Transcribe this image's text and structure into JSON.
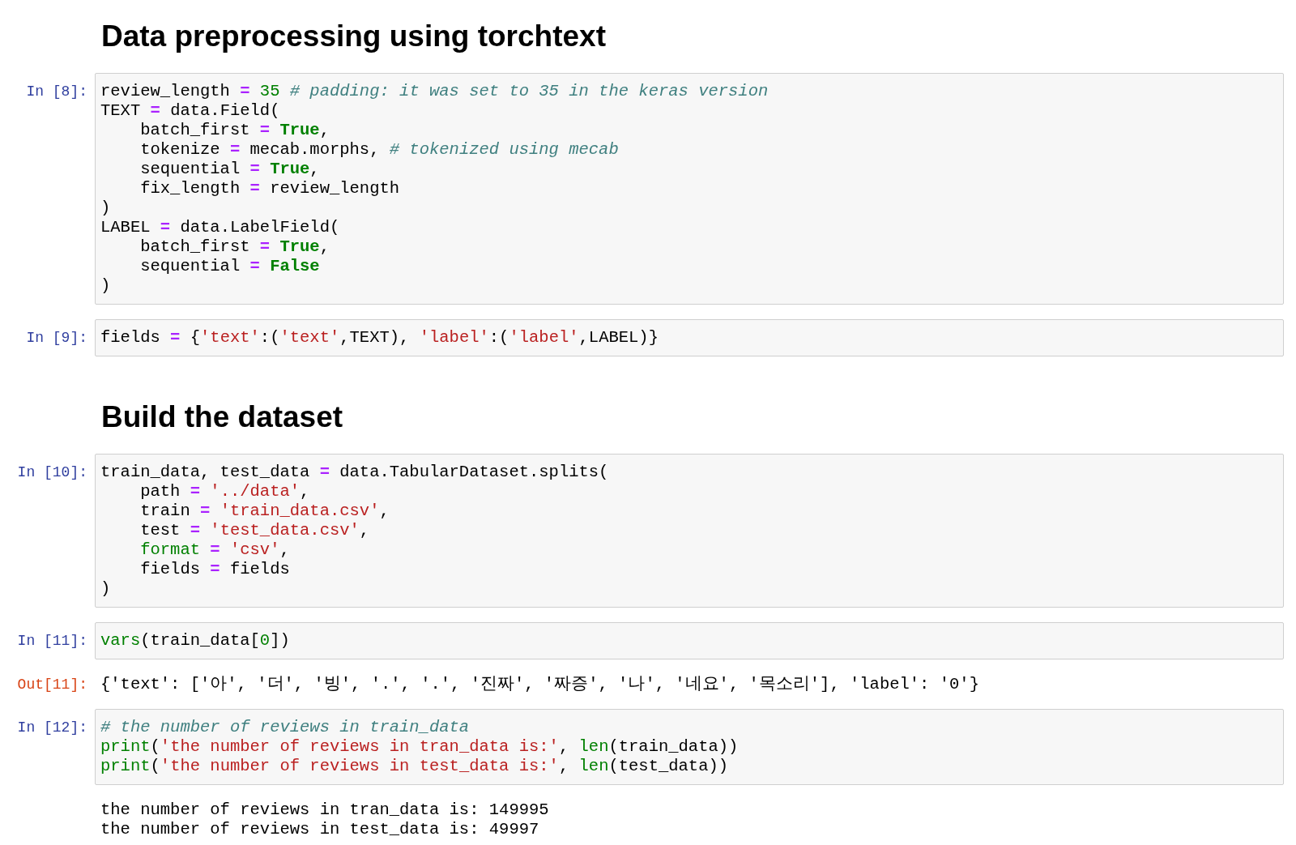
{
  "cells": [
    {
      "kind": "heading",
      "text": "Data preprocessing using torchtext"
    },
    {
      "kind": "code",
      "prompt": "In [8]:",
      "lines": [
        [
          {
            "text": "review_length",
            "kind": "plain"
          },
          {
            "text": " = ",
            "kind": "op"
          },
          {
            "text": "35",
            "kind": "num"
          },
          {
            "text": " # padding: it was set to 35 in the keras version",
            "kind": "comment"
          }
        ],
        [
          {
            "text": "TEXT",
            "kind": "plain"
          },
          {
            "text": " = ",
            "kind": "op"
          },
          {
            "text": "data.Field(",
            "kind": "plain"
          }
        ],
        [
          {
            "text": "    batch_first",
            "kind": "plain"
          },
          {
            "text": " = ",
            "kind": "op"
          },
          {
            "text": "True",
            "kind": "keyword"
          },
          {
            "text": ",",
            "kind": "plain"
          }
        ],
        [
          {
            "text": "    tokenize",
            "kind": "plain"
          },
          {
            "text": " = ",
            "kind": "op"
          },
          {
            "text": "mecab.morphs, ",
            "kind": "plain"
          },
          {
            "text": "# tokenized using mecab",
            "kind": "comment"
          }
        ],
        [
          {
            "text": "    sequential",
            "kind": "plain"
          },
          {
            "text": " = ",
            "kind": "op"
          },
          {
            "text": "True",
            "kind": "keyword"
          },
          {
            "text": ",",
            "kind": "plain"
          }
        ],
        [
          {
            "text": "    fix_length",
            "kind": "plain"
          },
          {
            "text": " = ",
            "kind": "op"
          },
          {
            "text": "review_length",
            "kind": "plain"
          }
        ],
        [
          {
            "text": ")",
            "kind": "plain"
          }
        ],
        [
          {
            "text": "LABEL",
            "kind": "plain"
          },
          {
            "text": " = ",
            "kind": "op"
          },
          {
            "text": "data.LabelField(",
            "kind": "plain"
          }
        ],
        [
          {
            "text": "    batch_first",
            "kind": "plain"
          },
          {
            "text": " = ",
            "kind": "op"
          },
          {
            "text": "True",
            "kind": "keyword"
          },
          {
            "text": ",",
            "kind": "plain"
          }
        ],
        [
          {
            "text": "    sequential",
            "kind": "plain"
          },
          {
            "text": " = ",
            "kind": "op"
          },
          {
            "text": "False",
            "kind": "keyword"
          }
        ],
        [
          {
            "text": ")",
            "kind": "plain"
          }
        ]
      ]
    },
    {
      "kind": "code",
      "prompt": "In [9]:",
      "lines": [
        [
          {
            "text": "fields",
            "kind": "plain"
          },
          {
            "text": " = ",
            "kind": "op"
          },
          {
            "text": "{",
            "kind": "plain"
          },
          {
            "text": "'text'",
            "kind": "string"
          },
          {
            "text": ":(",
            "kind": "plain"
          },
          {
            "text": "'text'",
            "kind": "string"
          },
          {
            "text": ",TEXT), ",
            "kind": "plain"
          },
          {
            "text": "'label'",
            "kind": "string"
          },
          {
            "text": ":(",
            "kind": "plain"
          },
          {
            "text": "'label'",
            "kind": "string"
          },
          {
            "text": ",LABEL)}",
            "kind": "plain"
          }
        ]
      ]
    },
    {
      "kind": "heading",
      "text": "Build the dataset"
    },
    {
      "kind": "code",
      "prompt": "In [10]:",
      "lines": [
        [
          {
            "text": "train_data, test_data",
            "kind": "plain"
          },
          {
            "text": " = ",
            "kind": "op"
          },
          {
            "text": "data.TabularDataset.splits(",
            "kind": "plain"
          }
        ],
        [
          {
            "text": "    path",
            "kind": "plain"
          },
          {
            "text": " = ",
            "kind": "op"
          },
          {
            "text": "'../data'",
            "kind": "string"
          },
          {
            "text": ",",
            "kind": "plain"
          }
        ],
        [
          {
            "text": "    train",
            "kind": "plain"
          },
          {
            "text": " = ",
            "kind": "op"
          },
          {
            "text": "'train_data.csv'",
            "kind": "string"
          },
          {
            "text": ",",
            "kind": "plain"
          }
        ],
        [
          {
            "text": "    test",
            "kind": "plain"
          },
          {
            "text": " = ",
            "kind": "op"
          },
          {
            "text": "'test_data.csv'",
            "kind": "string"
          },
          {
            "text": ",",
            "kind": "plain"
          }
        ],
        [
          {
            "text": "    format",
            "kind": "builtin"
          },
          {
            "text": " = ",
            "kind": "op"
          },
          {
            "text": "'csv'",
            "kind": "string"
          },
          {
            "text": ",",
            "kind": "plain"
          }
        ],
        [
          {
            "text": "    fields",
            "kind": "plain"
          },
          {
            "text": " = ",
            "kind": "op"
          },
          {
            "text": "fields",
            "kind": "plain"
          }
        ],
        [
          {
            "text": ")",
            "kind": "plain"
          }
        ]
      ]
    },
    {
      "kind": "code",
      "prompt": "In [11]:",
      "lines": [
        [
          {
            "text": "vars",
            "kind": "builtin"
          },
          {
            "text": "(train_data[",
            "kind": "plain"
          },
          {
            "text": "0",
            "kind": "num"
          },
          {
            "text": "])",
            "kind": "plain"
          }
        ]
      ]
    },
    {
      "kind": "output",
      "prompt": "Out[11]:",
      "lines": [
        "{'text': ['아', '더', '빙', '.', '.', '진짜', '짜증', '나', '네요', '목소리'], 'label': '0'}"
      ]
    },
    {
      "kind": "code",
      "prompt": "In [12]:",
      "lines": [
        [
          {
            "text": "# the number of reviews in train_data",
            "kind": "comment"
          }
        ],
        [
          {
            "text": "print",
            "kind": "builtin"
          },
          {
            "text": "(",
            "kind": "plain"
          },
          {
            "text": "'the number of reviews in tran_data is:'",
            "kind": "string"
          },
          {
            "text": ", ",
            "kind": "plain"
          },
          {
            "text": "len",
            "kind": "builtin"
          },
          {
            "text": "(train_data))",
            "kind": "plain"
          }
        ],
        [
          {
            "text": "print",
            "kind": "builtin"
          },
          {
            "text": "(",
            "kind": "plain"
          },
          {
            "text": "'the number of reviews in test_data is:'",
            "kind": "string"
          },
          {
            "text": ", ",
            "kind": "plain"
          },
          {
            "text": "len",
            "kind": "builtin"
          },
          {
            "text": "(test_data))",
            "kind": "plain"
          }
        ]
      ]
    },
    {
      "kind": "output",
      "lines": [
        "the number of reviews in tran_data is: 149995",
        "the number of reviews in test_data is: 49997"
      ]
    }
  ]
}
